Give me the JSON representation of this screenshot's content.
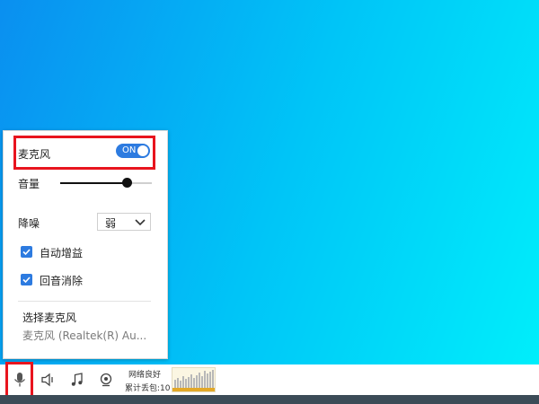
{
  "panel": {
    "mic_label": "麦克风",
    "mic_toggle": "ON",
    "volume_label": "音量",
    "volume_level": 0.73,
    "noise_label": "降噪",
    "noise_value": "弱",
    "auto_gain_label": "自动增益",
    "auto_gain_checked": true,
    "echo_cancel_label": "回音消除",
    "echo_cancel_checked": true,
    "select_mic_label": "选择麦克风",
    "mic_device": "麦克风 (Realtek(R) Au..."
  },
  "toolbar": {
    "icons": [
      "microphone-icon",
      "speaker-icon",
      "music-icon",
      "camera-icon"
    ],
    "network_status": "网络良好",
    "packet_loss": "累计丢包:10"
  },
  "colors": {
    "accent": "#2d7be0",
    "highlight": "#e8141e",
    "graph_bar": "#b8b8b8",
    "graph_base": "#e2a828"
  }
}
